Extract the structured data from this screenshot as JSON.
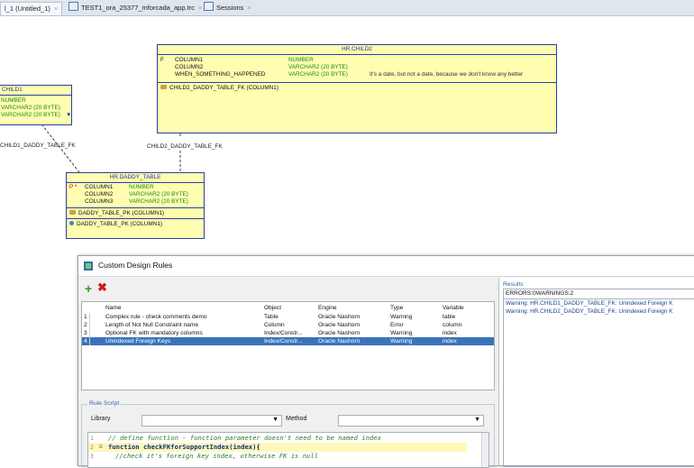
{
  "tabs": [
    {
      "label": "l_1 (Untitled_1)",
      "active": true
    },
    {
      "label": "TEST1_ora_25377_mforcada_app.trc",
      "active": false
    },
    {
      "label": "Sessions",
      "active": false
    }
  ],
  "diagram": {
    "child2": {
      "title": "HR.CHILD2",
      "flag": "F",
      "columns": [
        {
          "name": "COLUMN1",
          "type": "NUMBER",
          "comment": ""
        },
        {
          "name": "COLUMN2",
          "type": "VARCHAR2 (20 BYTE)",
          "comment": ""
        },
        {
          "name": "WHEN_SOMETHING_HAPPENED",
          "type": "VARCHAR2 (20 BYTE)",
          "comment": "It's a date, but not a date, because we don't know any better"
        }
      ],
      "keys": [
        "CHILD2_DADDY_TABLE_FK (COLUMN1)"
      ]
    },
    "child1": {
      "title": "CHILD1",
      "types": [
        "NUMBER",
        "VARCHAR2 (20 BYTE)",
        "VARCHAR2 (20 BYTE)"
      ]
    },
    "daddy": {
      "title": "HR.DADDY_TABLE",
      "flags": "P *",
      "columns": [
        {
          "name": "COLUMN1",
          "type": "NUMBER"
        },
        {
          "name": "COLUMN2",
          "type": "VARCHAR2 (20 BYTE)"
        },
        {
          "name": "COLUMN3",
          "type": "VARCHAR2 (20 BYTE)"
        }
      ],
      "keys": [
        "DADDY_TABLE_PK (COLUMN1)",
        "DADDY_TABLE_PK (COLUMN1)"
      ]
    },
    "relations": {
      "child1_fk": "CHILD1_DADDY_TABLE_FK",
      "child2_fk": "CHILD2_DADDY_TABLE_FK"
    }
  },
  "dialog": {
    "title": "Custom Design Rules",
    "add_icon": "+",
    "delete_icon": "✖",
    "columns": [
      "Name",
      "Object",
      "Engine",
      "Type",
      "Variable"
    ],
    "rules": [
      {
        "num": "1",
        "name": "Complex rule - check comments demo",
        "object": "Table",
        "engine": "Oracle Nashorn",
        "type": "Warning",
        "variable": "table"
      },
      {
        "num": "2",
        "name": "Length of Not Null Constraint name",
        "object": "Column",
        "engine": "Oracle Nashorn",
        "type": "Error",
        "variable": "column"
      },
      {
        "num": "3",
        "name": "Optional FK with mandatory columns",
        "object": "Index/Constr...",
        "engine": "Oracle Nashorn",
        "type": "Warning",
        "variable": "index"
      },
      {
        "num": "4",
        "name": "Unindexed Foreign Keys",
        "object": "Index/Constr...",
        "engine": "Oracle Nashorn",
        "type": "Warning",
        "variable": "index"
      }
    ],
    "selected_rule": 4,
    "results": {
      "label": "Results",
      "status": "ERRORS:0WARNINGS:2",
      "warnings": [
        "Warning: HR.CHILD1_DADDY_TABLE_FK: Unindexed Foreign K",
        "Warning: HR.CHILD2_DADDY_TABLE_FK: Unindexed Foreign K"
      ]
    },
    "rule_script": {
      "label": "Rule Script",
      "library_label": "Library",
      "library_value": "",
      "method_label": "Method",
      "method_value": "",
      "lines": [
        {
          "n": "1",
          "text": "// define function - function parameter doesn't need to be named index",
          "kind": "comment"
        },
        {
          "n": "2",
          "text": "function checkFKforSupportIndex(index){",
          "kind": "code"
        },
        {
          "n": "3",
          "text": "//check it's foreign key index, otherwise FK is null",
          "kind": "comment"
        }
      ]
    }
  }
}
